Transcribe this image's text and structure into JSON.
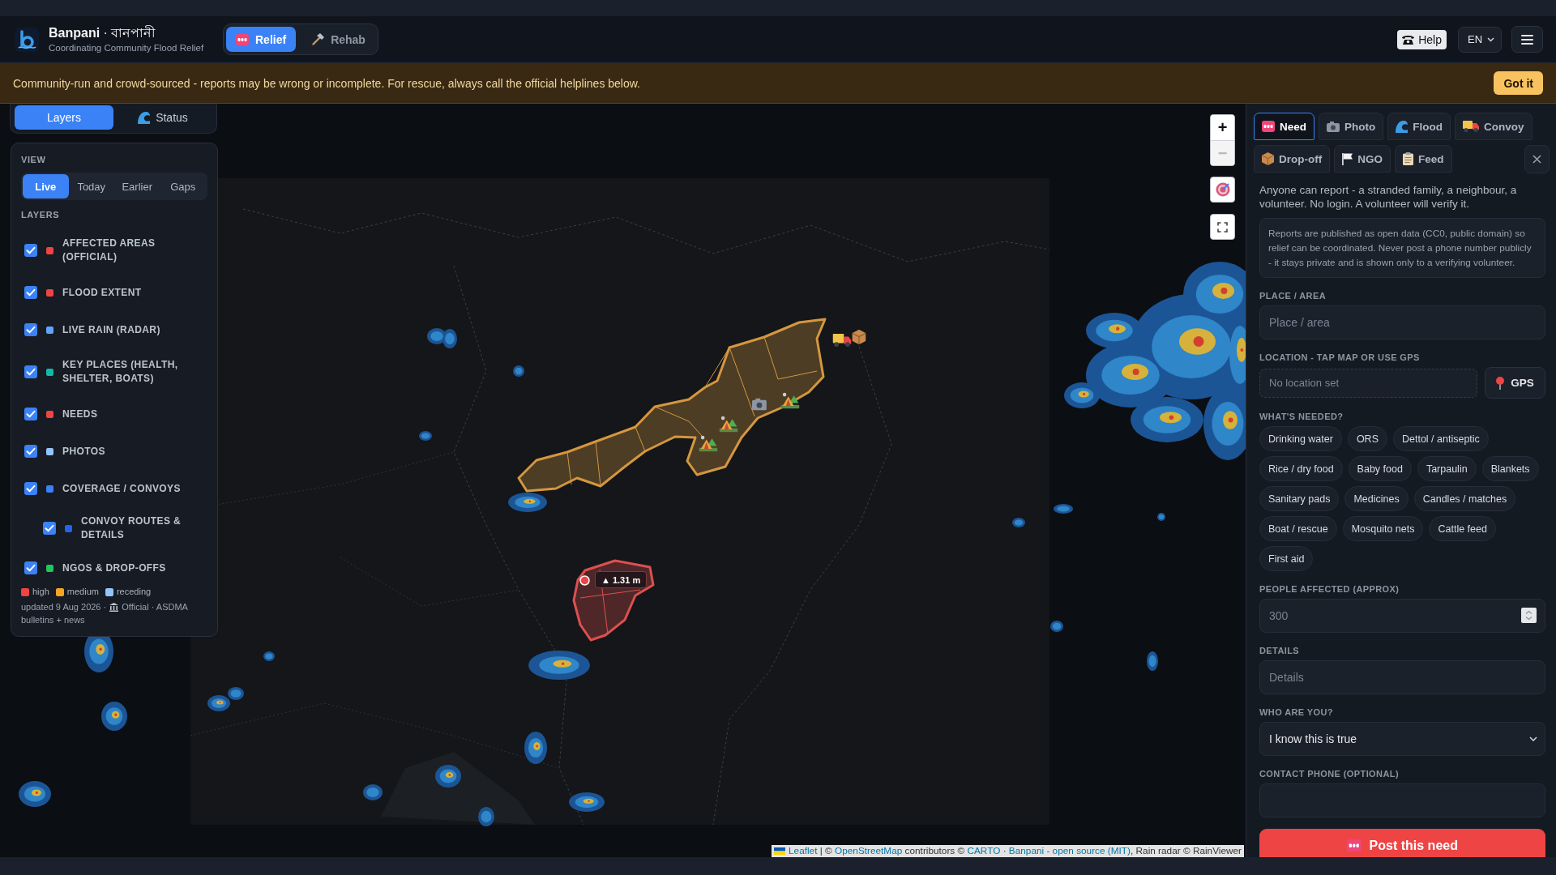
{
  "header": {
    "title": "**Banpani** · বানপানী",
    "subtitle": "Coordinating Community Flood Relief",
    "modes": [
      {
        "label": "Relief",
        "kind": "sos",
        "selected": true
      },
      {
        "label": "Rehab",
        "kind": "hammer",
        "selected": false
      }
    ],
    "help": "Help",
    "language": "EN"
  },
  "banner": {
    "text": "Community-run and crowd-sourced - reports may be wrong or incomplete. For rescue, always call the official helplines below.",
    "button": "Got it"
  },
  "layers_panel": {
    "tabs": [
      {
        "label": "Layers",
        "kind": "plain",
        "selected": true
      },
      {
        "label": "Status",
        "kind": "wave",
        "selected": false
      }
    ],
    "view_label": "VIEW",
    "view_options": [
      {
        "label": "Live",
        "selected": true
      },
      {
        "label": "Today",
        "selected": false
      },
      {
        "label": "Earlier",
        "selected": false
      },
      {
        "label": "Gaps",
        "selected": false
      }
    ],
    "layers_label": "LAYERS",
    "layers": [
      {
        "label": "AFFECTED AREAS (OFFICIAL)",
        "checked": true,
        "color": "#ef4444"
      },
      {
        "label": "FLOOD EXTENT",
        "checked": true,
        "color": "#ef4444"
      },
      {
        "label": "LIVE RAIN (RADAR)",
        "checked": true,
        "color": "#60a5fa"
      },
      {
        "label": "KEY PLACES (HEALTH, SHELTER, BOATS)",
        "checked": true,
        "color": "#14b8a6"
      },
      {
        "label": "NEEDS",
        "checked": true,
        "color": "#ef4444"
      },
      {
        "label": "PHOTOS",
        "checked": true,
        "color": "#93c5fd"
      },
      {
        "label": "COVERAGE / CONVOYS",
        "checked": true,
        "color": "#3b82f6",
        "children": [
          {
            "label": "CONVOY ROUTES & DETAILS",
            "checked": true,
            "color": "#2563eb"
          }
        ]
      },
      {
        "label": "NGOS & DROP-OFFS",
        "checked": true,
        "color": "#22c55e"
      }
    ],
    "legend": [
      {
        "label": "high",
        "color": "#ef4444"
      },
      {
        "label": "medium",
        "color": "#f5a524"
      },
      {
        "label": "receding",
        "color": "#93c5fd"
      }
    ],
    "updated": "updated 9 Aug 2026 ·",
    "source_lines": [
      "Official · ASDMA",
      "bulletins + news"
    ]
  },
  "map": {
    "areas": [
      {
        "color": "#d4973f"
      },
      {
        "color": "#dc5050"
      }
    ],
    "markers": [
      {
        "kind": "truck"
      },
      {
        "kind": "box"
      },
      {
        "kind": "camera"
      },
      {
        "kind": "tent"
      },
      {
        "kind": "tent"
      },
      {
        "kind": "tent"
      }
    ],
    "gauge": {
      "label": "▲ 1.31 m"
    },
    "zoom": [
      {
        "label": "+",
        "disabled": false
      },
      {
        "label": "−",
        "disabled": true
      }
    ],
    "attribution": [
      {
        "text": "Leaflet",
        "kind": "link"
      },
      {
        "text": " | © ",
        "kind": "text"
      },
      {
        "text": "OpenStreetMap",
        "kind": "link"
      },
      {
        "text": " contributors © ",
        "kind": "text"
      },
      {
        "text": "CARTO",
        "kind": "link"
      },
      {
        "text": " · ",
        "kind": "text"
      },
      {
        "text": "Banpani - open source (MIT)",
        "kind": "link"
      },
      {
        "text": ", Rain radar © RainViewer",
        "kind": "text"
      }
    ]
  },
  "report": {
    "tabs": [
      {
        "label": "Need",
        "kind": "sos",
        "selected": true
      },
      {
        "label": "Photo",
        "kind": "camera",
        "selected": false
      },
      {
        "label": "Flood",
        "kind": "wave",
        "selected": false
      },
      {
        "label": "Convoy",
        "kind": "truck",
        "selected": false
      },
      {
        "label": "Drop-off",
        "kind": "box",
        "selected": false
      },
      {
        "label": "NGO",
        "kind": "flag",
        "selected": false
      },
      {
        "label": "Feed",
        "kind": "clipboard",
        "selected": false
      }
    ],
    "intro": "Anyone can report - a stranded family, a neighbour, a volunteer. No login. A volunteer will verify it.",
    "notice": "Reports are published as open data (CC0, public domain) so relief can be coordinated. Never post a phone number publicly - it stays private and is shown only to a verifying volunteer.",
    "fields": [
      {
        "label": "PLACE / AREA",
        "kind": "text",
        "placeholder": "Place / area"
      },
      {
        "label": "LOCATION - TAP MAP OR USE GPS",
        "kind": "location",
        "value": "No location set",
        "button": "GPS"
      },
      {
        "label": "WHAT'S NEEDED?",
        "kind": "chips",
        "options": [
          {
            "label": "Drinking water",
            "selected": false
          },
          {
            "label": "ORS",
            "selected": false
          },
          {
            "label": "Dettol / antiseptic",
            "selected": false
          },
          {
            "label": "Rice / dry food",
            "selected": false
          },
          {
            "label": "Baby food",
            "selected": false
          },
          {
            "label": "Tarpaulin",
            "selected": false
          },
          {
            "label": "Blankets",
            "selected": false
          },
          {
            "label": "Sanitary pads",
            "selected": false
          },
          {
            "label": "Medicines",
            "selected": false
          },
          {
            "label": "Candles / matches",
            "selected": false
          },
          {
            "label": "Boat / rescue",
            "selected": false
          },
          {
            "label": "Mosquito nets",
            "selected": false
          },
          {
            "label": "Cattle feed",
            "selected": false
          },
          {
            "label": "First aid",
            "selected": false
          }
        ]
      },
      {
        "label": "PEOPLE AFFECTED (APPROX)",
        "kind": "number",
        "placeholder": "300"
      },
      {
        "label": "DETAILS",
        "kind": "text",
        "placeholder": "Details"
      },
      {
        "label": "WHO ARE YOU?",
        "kind": "select",
        "value": "I know this is true"
      },
      {
        "label": "CONTACT PHONE (OPTIONAL)",
        "kind": "text"
      }
    ],
    "submit": "Post this need"
  }
}
